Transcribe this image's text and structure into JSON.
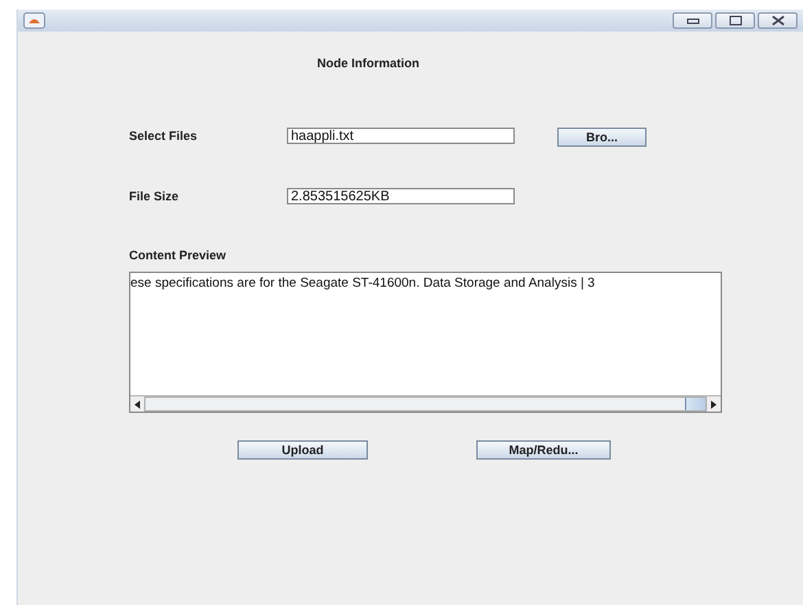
{
  "window": {
    "title": "Node Information"
  },
  "select_files": {
    "label": "Select Files",
    "value": "haappli.txt",
    "button": "Bro..."
  },
  "file_size": {
    "label": "File Size",
    "value": "2.853515625KB"
  },
  "content_preview": {
    "label": "Content Preview",
    "text": "ese specifications are for the Seagate ST-41600n. Data Storage and Analysis | 3"
  },
  "buttons": [
    "Upload",
    "Map/Redu..."
  ]
}
